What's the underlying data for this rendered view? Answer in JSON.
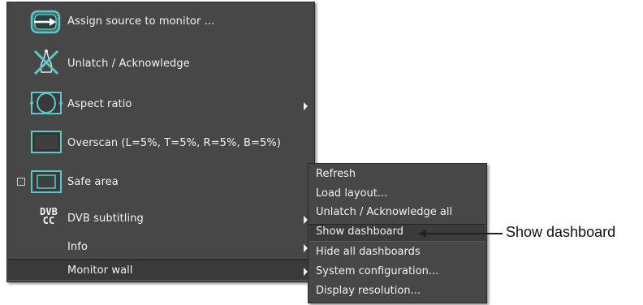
{
  "context_menu": {
    "items": [
      {
        "label": "Assign source to monitor ...",
        "icon": "assign-source-icon",
        "has_submenu": false
      },
      {
        "label": "Unlatch / Acknowledge",
        "icon": "unlatch-icon",
        "has_submenu": false
      },
      {
        "label": "Aspect ratio",
        "icon": "aspect-ratio-icon",
        "has_submenu": true
      },
      {
        "label": "Overscan (L=5%, T=5%, R=5%, B=5%)",
        "icon": "overscan-icon",
        "has_submenu": false
      },
      {
        "label": "Safe area",
        "icon": "safe-area-icon",
        "has_submenu": false,
        "checked": false
      },
      {
        "label": "DVB subtitling",
        "icon": "dvb-icon",
        "icon_text_top": "DVB",
        "icon_text_bottom": "CC",
        "has_submenu": true
      },
      {
        "label": "Info",
        "has_submenu": true
      },
      {
        "label": "Monitor wall",
        "has_submenu": true,
        "highlighted": true
      }
    ]
  },
  "submenu": {
    "items": [
      {
        "label": "Refresh"
      },
      {
        "label": "Load layout..."
      },
      {
        "label": "Unlatch / Acknowledge all"
      },
      {
        "label": "Show dashboard",
        "highlighted": true
      },
      {
        "label": "Hide all dashboards"
      },
      {
        "label": "System configuration..."
      },
      {
        "label": "Display resolution..."
      }
    ]
  },
  "callout": {
    "label": "Show dashboard"
  },
  "colors": {
    "menu_bg": "#474747",
    "text": "#f2f2f2",
    "icon_cyan": "#5ec8c8",
    "highlight": "#3a3a3a"
  }
}
